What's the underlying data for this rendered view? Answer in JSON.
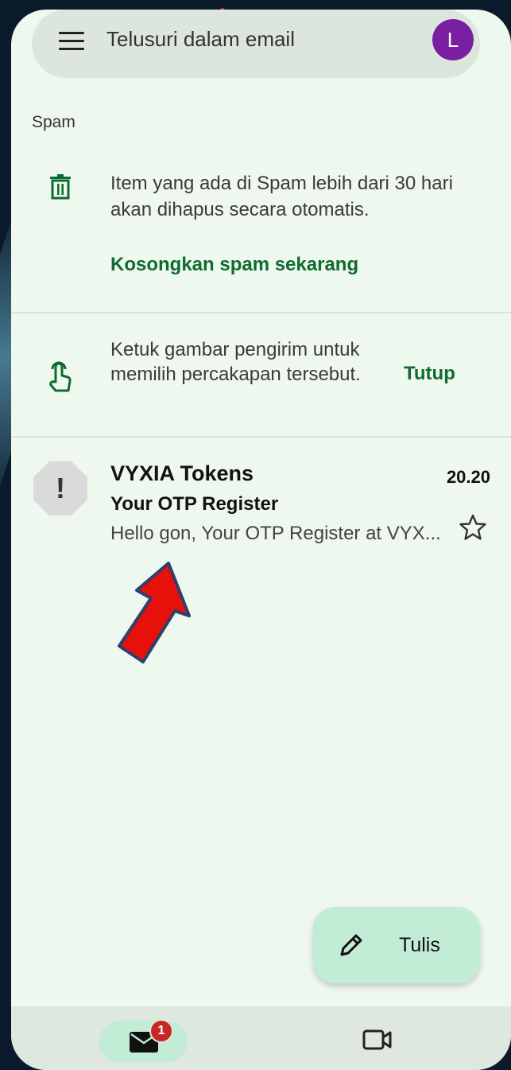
{
  "search": {
    "placeholder": "Telusuri dalam email"
  },
  "account": {
    "initial": "L",
    "color": "#7b1fa2"
  },
  "folder": {
    "label": "Spam"
  },
  "spam_notice": {
    "text": "Item yang ada di Spam lebih dari 30 hari akan dihapus secara otomatis.",
    "action": "Kosongkan spam sekarang"
  },
  "tip": {
    "text": "Ketuk gambar pengirim untuk memilih percakapan tersebut.",
    "dismiss": "Tutup"
  },
  "emails": [
    {
      "sender": "VYXIA Tokens",
      "time": "20.20",
      "subject": "Your OTP Register",
      "snippet": "Hello gon, Your OTP Register at VYX...",
      "avatar_icon": "!",
      "starred": false
    }
  ],
  "compose": {
    "label": "Tulis",
    "icon": "pencil-icon"
  },
  "bottom_nav": {
    "mail": {
      "icon": "mail-icon",
      "badge": "1",
      "active": true
    },
    "meet": {
      "icon": "video-camera-icon"
    }
  },
  "colors": {
    "accent_green": "#0f6b2f",
    "surface": "#eef8ee",
    "fab": "#c3ecd6",
    "badge": "#c62828",
    "annotation_arrow": "#e8100a"
  }
}
